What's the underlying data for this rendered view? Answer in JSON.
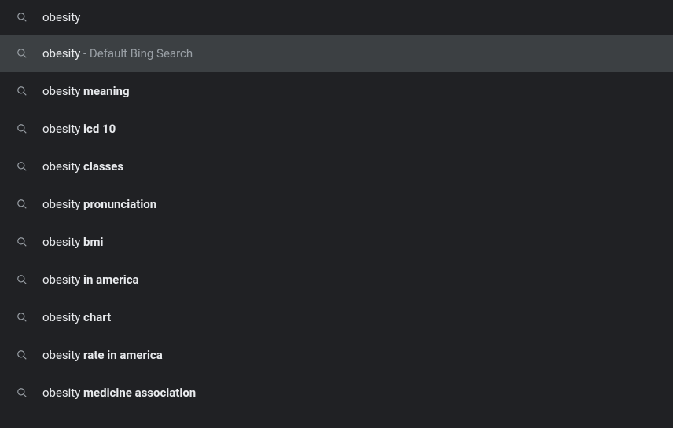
{
  "search": {
    "query": "obesity"
  },
  "default_suggestion": {
    "prefix": "obesity",
    "suffix": " - Default Bing Search"
  },
  "suggestions": [
    {
      "prefix": "obesity ",
      "bold": "meaning"
    },
    {
      "prefix": "obesity ",
      "bold": "icd 10"
    },
    {
      "prefix": "obesity ",
      "bold": "classes"
    },
    {
      "prefix": "obesity ",
      "bold": "pronunciation"
    },
    {
      "prefix": "obesity ",
      "bold": "bmi"
    },
    {
      "prefix": "obesity ",
      "bold": "in america"
    },
    {
      "prefix": "obesity ",
      "bold": "chart"
    },
    {
      "prefix": "obesity ",
      "bold": "rate in america"
    },
    {
      "prefix": "obesity ",
      "bold": "medicine association"
    }
  ]
}
